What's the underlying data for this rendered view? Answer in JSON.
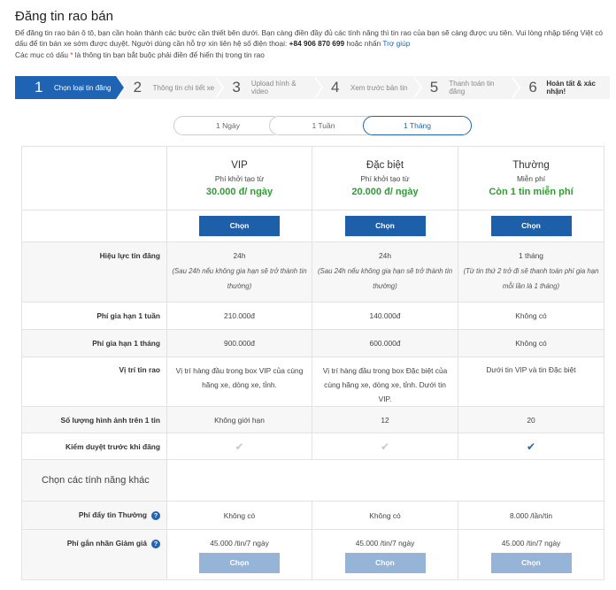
{
  "page": {
    "title": "Đăng tin rao bán",
    "intro_line1": "Để đăng tin rao bán ô tô, bạn cần hoàn thành các bước cần thiết bên dưới. Bạn càng điền đầy đủ các tính năng thì tin rao của bạn sẽ càng được ưu tiên. Vui lòng nhập tiếng Việt có dấu để tin bán xe sớm được duyệt. Người dùng cần hỗ trợ xin liên hệ số điện thoại: ",
    "phone": "+84 906 870 699",
    "intro_or": " hoặc nhấn ",
    "help_link": "Trợ giúp",
    "required_prefix": "Các mục có dấu ",
    "required_mark": "*",
    "required_suffix": " là thông tin bạn bắt buộc phải điền để hiển thị trong tin rao"
  },
  "steps": [
    {
      "num": "1",
      "label": "Chọn loại tin đăng"
    },
    {
      "num": "2",
      "label": "Thông tin chi tiết xe"
    },
    {
      "num": "3",
      "label": "Upload hình & video"
    },
    {
      "num": "4",
      "label": "Xem trước bản tin"
    },
    {
      "num": "5",
      "label": "Thanh toán tin đăng"
    },
    {
      "num": "6",
      "label": "Hoàn tất & xác nhận!"
    }
  ],
  "durations": {
    "options": [
      "1 Ngày",
      "1 Tuần",
      "1 Tháng"
    ],
    "selected": "1 Tháng"
  },
  "plans": [
    {
      "name": "VIP",
      "sub": "Phí khởi tạo từ",
      "price": "30.000 đ/ ngày",
      "button": "Chọn"
    },
    {
      "name": "Đặc biệt",
      "sub": "Phí khởi tạo từ",
      "price": "20.000 đ/ ngày",
      "button": "Chọn"
    },
    {
      "name": "Thường",
      "sub": "Miễn phí",
      "price": "Còn 1 tin miễn phí",
      "button": "Chọn"
    }
  ],
  "rows": {
    "validity": {
      "label": "Hiệu lực tin đăng",
      "values": [
        "24h",
        "24h",
        "1 tháng"
      ],
      "notes": [
        "(Sau 24h nếu không gia hạn sẽ trở thành tin thường)",
        "(Sau 24h nếu không gia hạn sẽ trở thành tin thường)",
        "(Từ tin thứ 2 trở đi sẽ thanh toán phí gia hạn mỗi lần là 1 tháng)"
      ]
    },
    "week_fee": {
      "label": "Phí gia hạn 1 tuần",
      "values": [
        "210.000đ",
        "140.000đ",
        "Không có"
      ]
    },
    "month_fee": {
      "label": "Phí gia hạn 1 tháng",
      "values": [
        "900.000đ",
        "600.000đ",
        "Không có"
      ]
    },
    "position": {
      "label": "Vị trí tin rao",
      "values": [
        "Vị trí hàng đầu trong box VIP của cùng hãng xe, dòng xe, tỉnh.",
        "Vị trí hàng đầu trong box Đặc biệt của cùng hãng xe, dòng xe, tỉnh. Dưới tin VIP.",
        "Dưới tin VIP và tin Đặc biệt"
      ]
    },
    "images": {
      "label": "Số lượng hình ảnh trên 1 tin",
      "values": [
        "Không giới hạn",
        "12",
        "20"
      ]
    },
    "review": {
      "label": "Kiểm duyệt trước khi đăng",
      "checked": [
        false,
        false,
        true
      ]
    }
  },
  "extras": {
    "title": "Chọn các tính năng khác",
    "push": {
      "label": "Phí đẩy tin Thường",
      "values": [
        "Không có",
        "Không có",
        "8.000 /lần/tin"
      ]
    },
    "badge": {
      "label": "Phí gắn nhãn Giảm giá",
      "values": [
        "45.000 /tin/7 ngày",
        "45.000 /tin/7 ngày",
        "45.000 /tin/7 ngày"
      ],
      "button": "Chọn"
    }
  },
  "colors": {
    "accent": "#1e63b4",
    "price_green": "#2e9e33",
    "required_red": "#e53935"
  },
  "icons": {
    "check": "check-icon",
    "info": "info-icon"
  }
}
